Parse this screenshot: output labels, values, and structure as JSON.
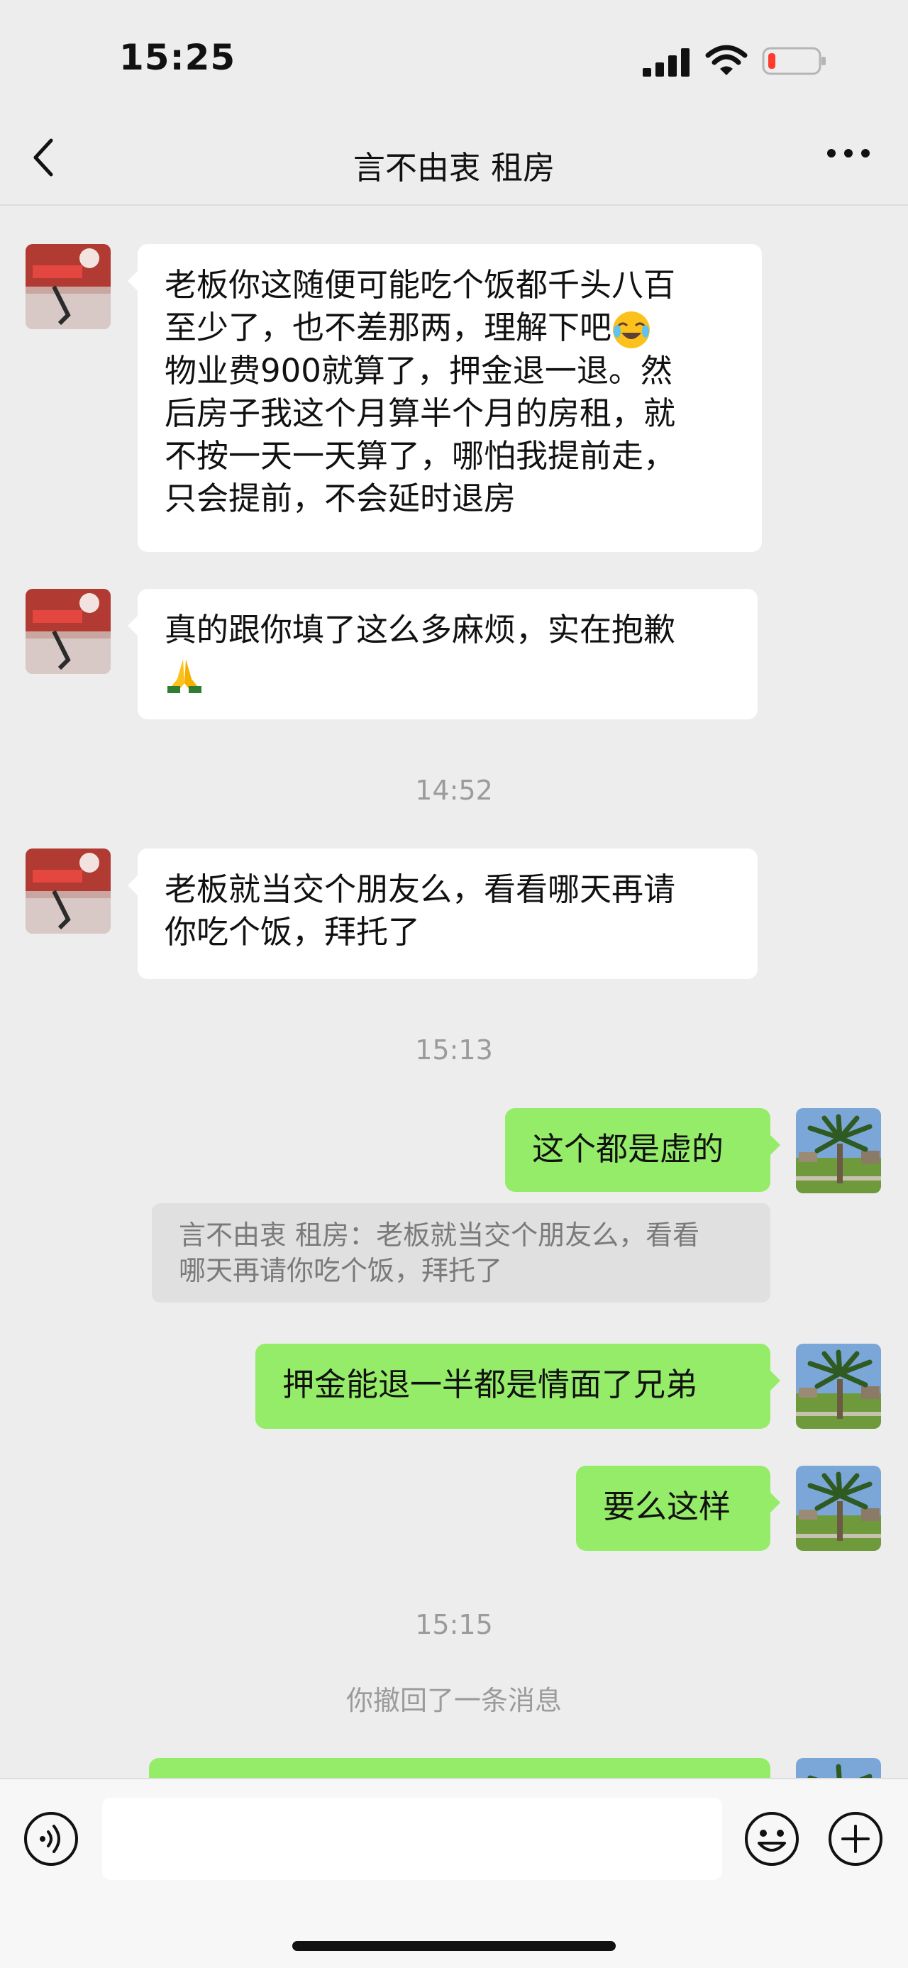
{
  "status_bar": {
    "time": "15:25",
    "battery_color": "#ff3b30"
  },
  "header": {
    "title": "言不由衷 租房",
    "back_icon": "chevron-left-icon",
    "more_icon": "more-dots-icon"
  },
  "messages": [
    {
      "direction": "incoming",
      "lines": [
        "老板你这随便可能吃个饭都千头八百",
        "至少了，也不差那两，理解下吧",
        "物业费900就算了，押金退一退。然",
        "后房子我这个月算半个月的房租，就",
        "不按一天一天算了，哪怕我提前走，",
        "只会提前，不会延时退房"
      ],
      "emoji": "crying-laughing-emoji"
    },
    {
      "direction": "incoming",
      "lines": [
        "真的跟你填了这么多麻烦，实在抱歉"
      ],
      "emoji": "folded-hands-emoji"
    },
    {
      "direction": "incoming",
      "lines": [
        "老板就当交个朋友么，看看哪天再请",
        "你吃个饭，拜托了"
      ]
    },
    {
      "direction": "outgoing",
      "text": "这个都是虚的"
    },
    {
      "direction": "outgoing",
      "text": "押金能退一半都是情面了兄弟"
    },
    {
      "direction": "outgoing",
      "text": "要么这样"
    }
  ],
  "timestamps": [
    "14:52",
    "15:13",
    "15:15"
  ],
  "quote": {
    "lines": [
      "言不由衷 租房：老板就当交个朋友么，看看",
      "哪天再请你吃个饭，拜托了"
    ]
  },
  "system_notice": "你撤回了一条消息",
  "input_bar": {
    "placeholder": "",
    "voice_icon": "voice-icon",
    "emoji_icon": "smiley-icon",
    "plus_icon": "plus-icon"
  },
  "colors": {
    "background": "#ededed",
    "outgoing_bubble": "#95ec69",
    "incoming_bubble": "#ffffff"
  }
}
